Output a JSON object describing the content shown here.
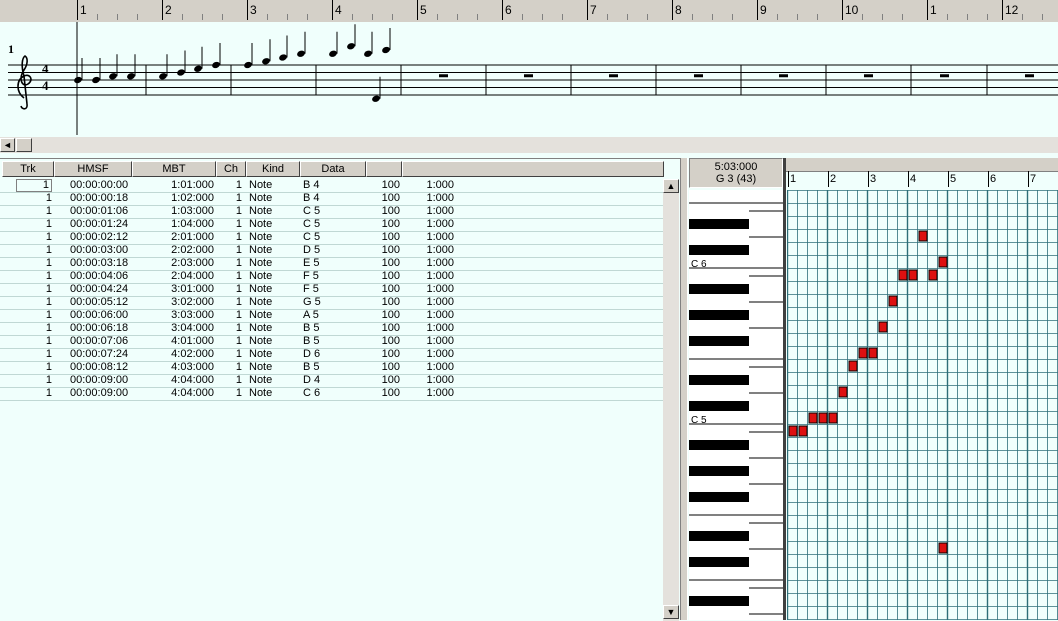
{
  "top_ruler": {
    "measures": [
      "1",
      "2",
      "3",
      "4",
      "5",
      "6",
      "7",
      "8",
      "9",
      "10",
      "1",
      "12"
    ]
  },
  "score": {
    "measure_number": "1",
    "time_signature": {
      "top": "4",
      "bottom": "4"
    },
    "clef": "treble-clef-icon"
  },
  "event_list": {
    "columns": [
      "Trk",
      "HMSF",
      "MBT",
      "Ch",
      "Kind",
      "Data"
    ],
    "rows": [
      {
        "trk": "1",
        "hmsf": "00:00:00:00",
        "mbt": "1:01:000",
        "ch": "1",
        "kind": "Note",
        "data": "B 4",
        "vel": "100",
        "dur": "1:000"
      },
      {
        "trk": "1",
        "hmsf": "00:00:00:18",
        "mbt": "1:02:000",
        "ch": "1",
        "kind": "Note",
        "data": "B 4",
        "vel": "100",
        "dur": "1:000"
      },
      {
        "trk": "1",
        "hmsf": "00:00:01:06",
        "mbt": "1:03:000",
        "ch": "1",
        "kind": "Note",
        "data": "C 5",
        "vel": "100",
        "dur": "1:000"
      },
      {
        "trk": "1",
        "hmsf": "00:00:01:24",
        "mbt": "1:04:000",
        "ch": "1",
        "kind": "Note",
        "data": "C 5",
        "vel": "100",
        "dur": "1:000"
      },
      {
        "trk": "1",
        "hmsf": "00:00:02:12",
        "mbt": "2:01:000",
        "ch": "1",
        "kind": "Note",
        "data": "C 5",
        "vel": "100",
        "dur": "1:000"
      },
      {
        "trk": "1",
        "hmsf": "00:00:03:00",
        "mbt": "2:02:000",
        "ch": "1",
        "kind": "Note",
        "data": "D 5",
        "vel": "100",
        "dur": "1:000"
      },
      {
        "trk": "1",
        "hmsf": "00:00:03:18",
        "mbt": "2:03:000",
        "ch": "1",
        "kind": "Note",
        "data": "E 5",
        "vel": "100",
        "dur": "1:000"
      },
      {
        "trk": "1",
        "hmsf": "00:00:04:06",
        "mbt": "2:04:000",
        "ch": "1",
        "kind": "Note",
        "data": "F 5",
        "vel": "100",
        "dur": "1:000"
      },
      {
        "trk": "1",
        "hmsf": "00:00:04:24",
        "mbt": "3:01:000",
        "ch": "1",
        "kind": "Note",
        "data": "F 5",
        "vel": "100",
        "dur": "1:000"
      },
      {
        "trk": "1",
        "hmsf": "00:00:05:12",
        "mbt": "3:02:000",
        "ch": "1",
        "kind": "Note",
        "data": "G 5",
        "vel": "100",
        "dur": "1:000"
      },
      {
        "trk": "1",
        "hmsf": "00:00:06:00",
        "mbt": "3:03:000",
        "ch": "1",
        "kind": "Note",
        "data": "A 5",
        "vel": "100",
        "dur": "1:000"
      },
      {
        "trk": "1",
        "hmsf": "00:00:06:18",
        "mbt": "3:04:000",
        "ch": "1",
        "kind": "Note",
        "data": "B 5",
        "vel": "100",
        "dur": "1:000"
      },
      {
        "trk": "1",
        "hmsf": "00:00:07:06",
        "mbt": "4:01:000",
        "ch": "1",
        "kind": "Note",
        "data": "B 5",
        "vel": "100",
        "dur": "1:000"
      },
      {
        "trk": "1",
        "hmsf": "00:00:07:24",
        "mbt": "4:02:000",
        "ch": "1",
        "kind": "Note",
        "data": "D 6",
        "vel": "100",
        "dur": "1:000"
      },
      {
        "trk": "1",
        "hmsf": "00:00:08:12",
        "mbt": "4:03:000",
        "ch": "1",
        "kind": "Note",
        "data": "B 5",
        "vel": "100",
        "dur": "1:000"
      },
      {
        "trk": "1",
        "hmsf": "00:00:09:00",
        "mbt": "4:04:000",
        "ch": "1",
        "kind": "Note",
        "data": "D 4",
        "vel": "100",
        "dur": "1:000"
      },
      {
        "trk": "1",
        "hmsf": "00:00:09:00",
        "mbt": "4:04:000",
        "ch": "1",
        "kind": "Note",
        "data": "C 6",
        "vel": "100",
        "dur": "1:000"
      }
    ]
  },
  "piano_roll": {
    "position": "5:03:000",
    "pitch": "G 3 (43)",
    "ruler_beats": [
      "1",
      "2",
      "3",
      "4",
      "5",
      "6",
      "7"
    ],
    "key_labels": {
      "c6": "C 6",
      "c5": "C 5"
    },
    "note_color": "#dd1010",
    "grid_color": "#2e6e78"
  },
  "colors": {
    "background": "#f0fffc",
    "panel": "#d4d0c8"
  }
}
